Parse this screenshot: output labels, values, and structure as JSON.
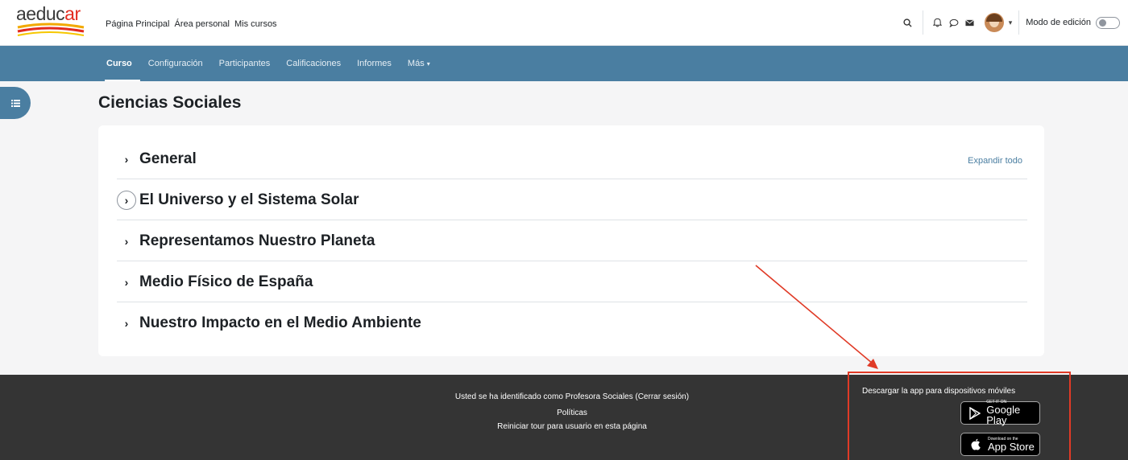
{
  "logo": {
    "text_main": "aeduc",
    "text_accent": "ar"
  },
  "topbar": {
    "nav": [
      "Página Principal",
      "Área personal",
      "Mis cursos"
    ],
    "edit_mode_label": "Modo de edición"
  },
  "secondary_nav": {
    "tabs": [
      "Curso",
      "Configuración",
      "Participantes",
      "Calificaciones",
      "Informes",
      "Más"
    ],
    "active": "Curso"
  },
  "course": {
    "title": "Ciencias Sociales",
    "expand_all": "Expandir todo",
    "sections": [
      "General",
      "El Universo y el Sistema Solar",
      "Representamos Nuestro Planeta",
      "Medio Físico de España",
      "Nuestro Impacto en el Medio Ambiente"
    ]
  },
  "footer": {
    "logged_in": "Usted se ha identificado como Profesora Sociales (Cerrar sesión)",
    "policies": "Políticas",
    "reset_tour": "Reiniciar tour para usuario en esta página",
    "app_title": "Descargar la app para dispositivos móviles",
    "google_small": "GET IT ON",
    "google_big": "Google Play",
    "apple_small": "Download on the",
    "apple_big": "App Store"
  },
  "colors": {
    "brand_blue": "#4a7ea1",
    "footer_bg": "#343434",
    "annotation_red": "#e03a26"
  }
}
